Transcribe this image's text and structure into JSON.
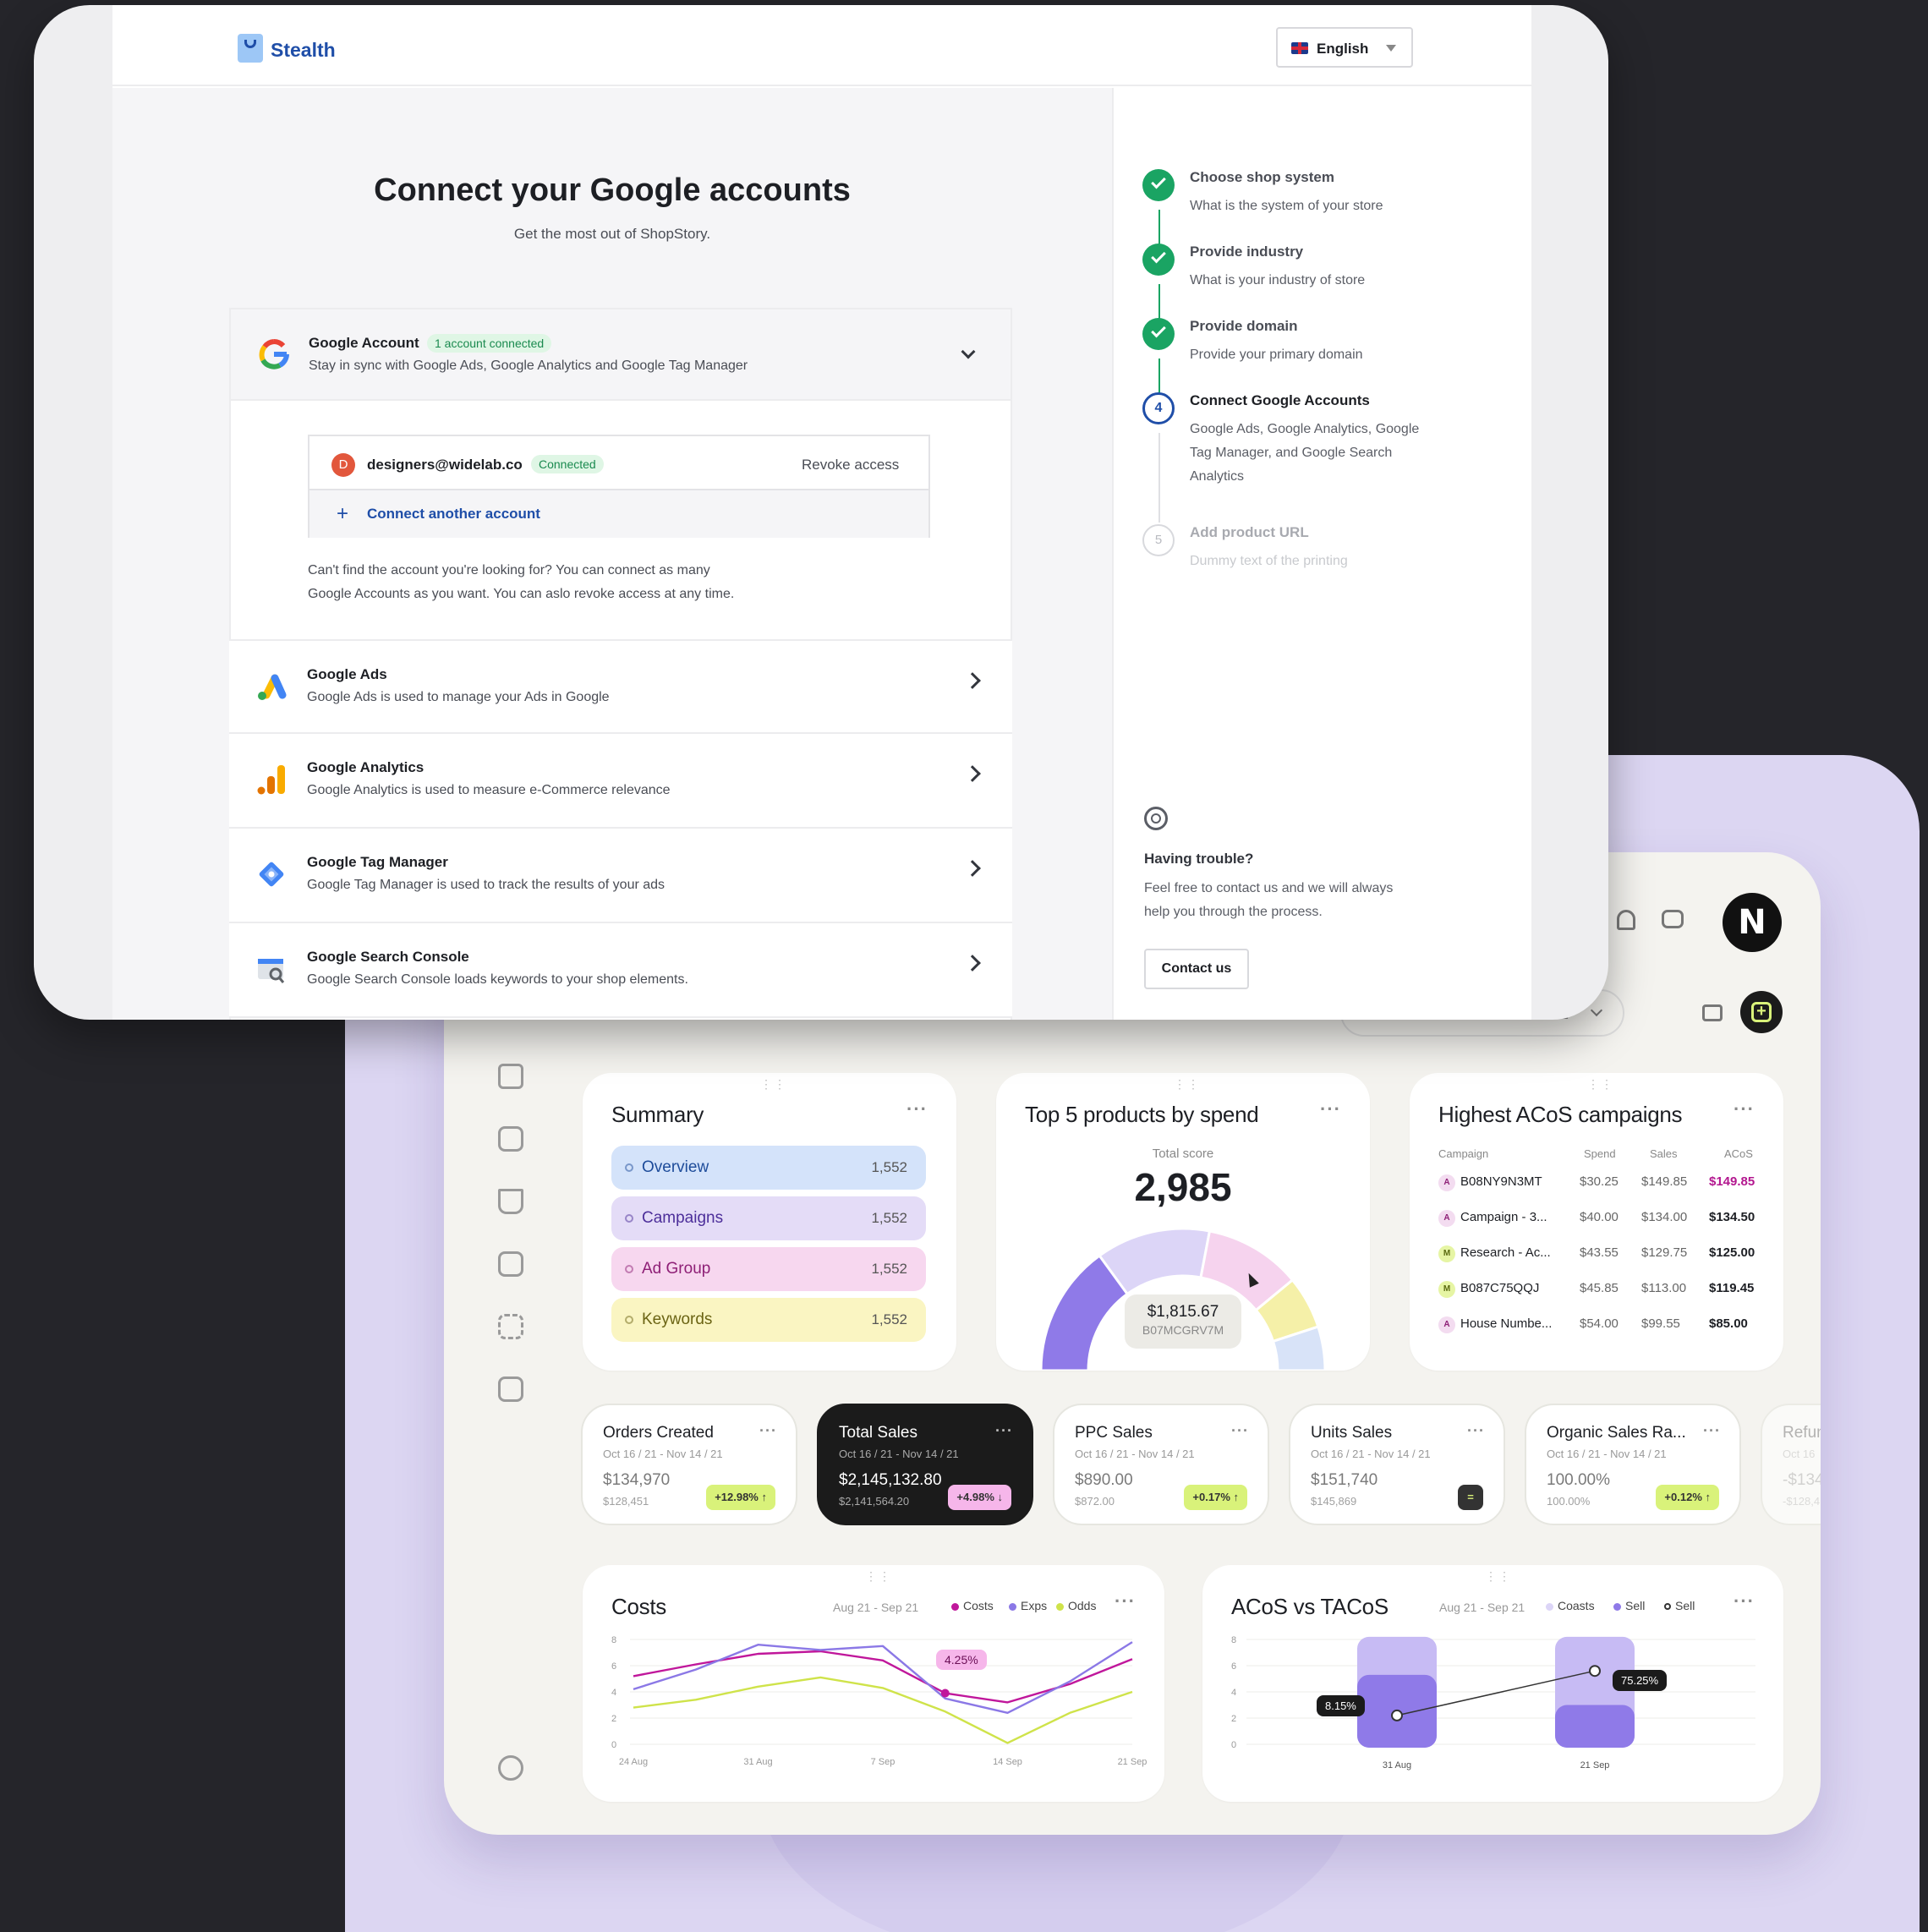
{
  "onboarding": {
    "brand": "Stealth",
    "language": "English",
    "title": "Connect your Google accounts",
    "subtitle": "Get the most out of ShopStory.",
    "google_account": {
      "title": "Google Account",
      "badge": "1 account connected",
      "description": "Stay in sync with Google Ads, Google Analytics and Google Tag Manager",
      "account_initial": "D",
      "account_email": "designers@widelab.co",
      "account_status": "Connected",
      "revoke_label": "Revoke access",
      "connect_another_label": "Connect another account",
      "help_line1": "Can't find the account you're looking for? You can connect as many",
      "help_line2": "Google Accounts as you want. You can aslo revoke access at any time."
    },
    "services": [
      {
        "title": "Google Ads",
        "description": "Google Ads is used to manage your Ads in Google"
      },
      {
        "title": "Google Analytics",
        "description": "Google Analytics is used to measure e-Commerce relevance"
      },
      {
        "title": "Google Tag Manager",
        "description": "Google Tag Manager is used to track the results of your ads"
      },
      {
        "title": "Google Search Console",
        "description": "Google Search Console loads keywords to your shop elements."
      }
    ],
    "steps": [
      {
        "title": "Choose shop system",
        "description": "What is the system of your store",
        "status": "done"
      },
      {
        "title": "Provide industry",
        "description": "What is your industry of store",
        "status": "done"
      },
      {
        "title": "Provide domain",
        "description": "Provide your primary domain",
        "status": "done"
      },
      {
        "number": "4",
        "title": "Connect Google Accounts",
        "description": "Google Ads, Google Analytics, Google Tag Manager, and Google Search Analytics",
        "status": "active"
      },
      {
        "number": "5",
        "title": "Add product URL",
        "description": "Dummy text of the printing",
        "status": "pending"
      }
    ],
    "help": {
      "title": "Having trouble?",
      "line1": "Feel free to contact us and we will always",
      "line2": "help you through the process.",
      "contact_label": "Contact us"
    }
  },
  "dashboard": {
    "date_range_partial": "/ 21",
    "summary": {
      "title": "Summary",
      "rows": [
        {
          "label": "Overview",
          "count": "1,552"
        },
        {
          "label": "Campaigns",
          "count": "1,552"
        },
        {
          "label": "Ad Group",
          "count": "1,552"
        },
        {
          "label": "Keywords",
          "count": "1,552"
        }
      ]
    },
    "top_products": {
      "title": "Top 5 products by spend",
      "total_label": "Total score",
      "total_value": "2,985",
      "tooltip_value": "$1,815.67",
      "tooltip_sku": "B07MCGRV7M"
    },
    "acos": {
      "title": "Highest ACoS campaigns",
      "headers": [
        "Campaign",
        "Spend",
        "Sales",
        "ACoS"
      ],
      "rows": [
        {
          "badge": "A",
          "campaign": "B08NY9N3MT",
          "spend": "$30.25",
          "sales": "$149.85",
          "acos": "$149.85"
        },
        {
          "badge": "A",
          "campaign": "Campaign - 3...",
          "spend": "$40.00",
          "sales": "$134.00",
          "acos": "$134.50"
        },
        {
          "badge": "M",
          "campaign": "Research - Ac...",
          "spend": "$43.55",
          "sales": "$129.75",
          "acos": "$125.00"
        },
        {
          "badge": "M",
          "campaign": "B087C75QQJ",
          "spend": "$45.85",
          "sales": "$113.00",
          "acos": "$119.45"
        },
        {
          "badge": "A",
          "campaign": "House Numbe...",
          "spend": "$54.00",
          "sales": "$99.55",
          "acos": "$85.00"
        }
      ]
    },
    "kpis": [
      {
        "title": "Orders Created",
        "dates": "Oct 16 / 21 - Nov 14 / 21",
        "value": "$134,970",
        "previous": "$128,451",
        "change": "+12.98%"
      },
      {
        "title": "Total Sales",
        "dates": "Oct 16 / 21 - Nov 14 / 21",
        "value": "$2,145,132.80",
        "previous": "$2,141,564.20",
        "change": "+4.98%"
      },
      {
        "title": "PPC Sales",
        "dates": "Oct 16 / 21 - Nov 14 / 21",
        "value": "$890.00",
        "previous": "$872.00",
        "change": "+0.17%"
      },
      {
        "title": "Units Sales",
        "dates": "Oct 16 / 21 - Nov 14 / 21",
        "value": "$151,740",
        "previous": "$145,869",
        "change": ""
      },
      {
        "title": "Organic Sales Ra...",
        "dates": "Oct 16 / 21 - Nov 14 / 21",
        "value": "100.00%",
        "previous": "100.00%",
        "change": "+0.12%"
      },
      {
        "title": "Refun",
        "dates": "Oct 16",
        "value": "-$134",
        "previous": "-$128,4",
        "change": ""
      }
    ],
    "costs_chart": {
      "title": "Costs",
      "date_range": "Aug 21 - Sep 21",
      "legend": [
        "Costs",
        "Exps",
        "Odds"
      ],
      "tooltip": "4.25%"
    },
    "acos_chart": {
      "title": "ACoS vs TACoS",
      "date_range": "Aug 21 - Sep 21",
      "legend": [
        "Coasts",
        "Sell",
        "Sell"
      ],
      "label_left": "8.15%",
      "label_right": "75.25%"
    }
  },
  "chart_data": [
    {
      "type": "line",
      "x": [
        "24 Aug",
        "31 Aug",
        "7 Sep",
        "14 Sep",
        "21 Sep"
      ],
      "yticks": [
        0,
        2,
        4,
        6,
        8
      ],
      "ylim": [
        0,
        8
      ],
      "series": [
        {
          "name": "Costs",
          "color": "#c0179b",
          "values": [
            5.2,
            6.1,
            6.9,
            7.1,
            6.4,
            3.9,
            3.2,
            4.6,
            6.5
          ]
        },
        {
          "name": "Exps",
          "color": "#8b78e6",
          "values": [
            4.2,
            5.7,
            7.6,
            7.2,
            7.5,
            3.5,
            2.4,
            4.8,
            7.8
          ]
        },
        {
          "name": "Odds",
          "color": "#cfe34a",
          "values": [
            2.8,
            3.4,
            4.4,
            5.1,
            4.3,
            2.5,
            0.1,
            2.4,
            4.0
          ]
        }
      ]
    },
    {
      "type": "bar",
      "categories": [
        "31 Aug",
        "21 Sep"
      ],
      "yticks": [
        0,
        2,
        4,
        6,
        8
      ],
      "ylim": [
        0,
        8
      ],
      "series": [
        {
          "name": "Coasts",
          "color": "#c7bbf4",
          "values": [
            8.2,
            8.2
          ]
        },
        {
          "name": "Sell",
          "color": "#8f7ae8",
          "values": [
            5.3,
            3.0
          ]
        },
        {
          "name": "Sell",
          "type": "line",
          "values": [
            2.2,
            5.6
          ]
        }
      ]
    },
    {
      "type": "pie",
      "title": "Top 5 products by spend",
      "segments": [
        {
          "color": "#8f7ae8",
          "value": 30
        },
        {
          "color": "#dcd5f7",
          "value": 26
        },
        {
          "color": "#f6d3ee",
          "value": 22
        },
        {
          "color": "#f5f0a8",
          "value": 12
        },
        {
          "color": "#d8e3f8",
          "value": 10
        }
      ]
    }
  ],
  "colors": {
    "brand_blue": "#1f4ea8",
    "success_green": "#1aa463",
    "accent_lime": "#d9f27a",
    "accent_pink": "#f6b6ea",
    "purple": "#8f7ae8"
  }
}
